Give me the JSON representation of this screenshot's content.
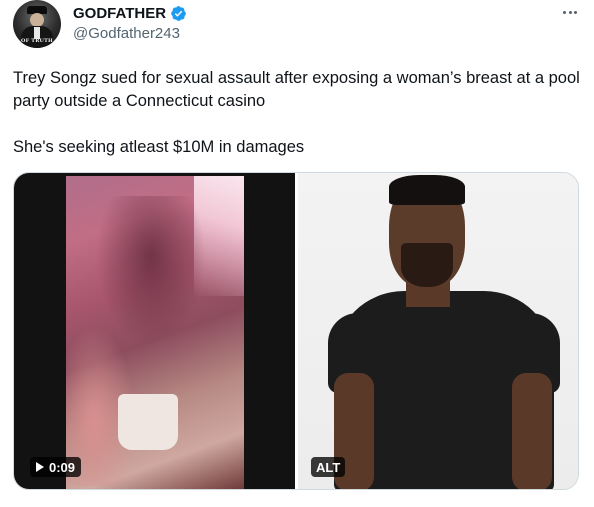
{
  "author": {
    "avatar_caption": "OF TRUTH",
    "display_name": "GODFATHER",
    "handle": "@Godfather243",
    "verified": true,
    "verified_color": "#1d9bf0"
  },
  "tweet": {
    "line1": "Trey Songz sued for sexual assault after exposing a woman’s breast at a pool party outside a Connecticut casino",
    "line2": "She's seeking atleast $10M in damages"
  },
  "media": {
    "video_duration": "0:09",
    "alt_label": "ALT"
  },
  "icons": {
    "more": "more-horizontal-icon",
    "verified": "verified-badge-icon",
    "play": "play-icon"
  },
  "colors": {
    "text_primary": "#0f1419",
    "text_secondary": "#536471",
    "border": "#cfd9de"
  }
}
